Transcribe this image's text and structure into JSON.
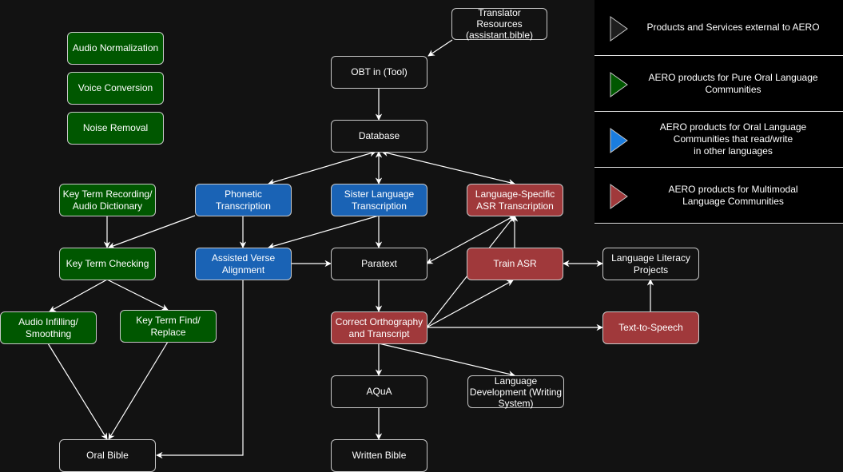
{
  "colors": {
    "background": "#121212",
    "external": "#121212",
    "pure_oral": "#005700",
    "oral_read_write": "#1a63b5",
    "multimodal": "#a0393b",
    "edge": "#ffffff",
    "border": "#c8c8c8"
  },
  "nodes": {
    "translator_resources": "Translator\nResources\n(assistant.bible)",
    "obt_tool": "OBT in (Tool)",
    "database": "Database",
    "audio_normalization": "Audio Normalization",
    "voice_conversion": "Voice Conversion",
    "noise_removal": "Noise Removal",
    "key_term_recording": "Key Term Recording/\nAudio Dictionary",
    "phonetic_transcription": "Phonetic\nTranscription",
    "sister_language_transcription": "Sister Language\nTranscription",
    "language_specific_asr": "Language-Specific\nASR Transcription",
    "key_term_checking": "Key Term Checking",
    "assisted_verse_alignment": "Assisted Verse\nAlignment",
    "paratext": "Paratext",
    "train_asr": "Train ASR",
    "language_literacy_projects": "Language Literacy\nProjects",
    "audio_infilling": "Audio Infilling/\nSmoothing",
    "key_term_find_replace": "Key Term Find/\nReplace",
    "correct_orthography": "Correct Orthography\nand Transcript",
    "text_to_speech": "Text-to-Speech",
    "aqua": "AQuA",
    "language_development": "Language\nDevelopment (Writing\nSystem)",
    "oral_bible": "Oral Bible",
    "written_bible": "Written Bible"
  },
  "legend": [
    {
      "label": "Products and Services external to AERO",
      "icon": "triangle-dark-icon",
      "color": "#1e1e1e"
    },
    {
      "label": "AERO products for Pure Oral Language\nCommunities",
      "icon": "triangle-green-icon",
      "color": "#005700"
    },
    {
      "label": "AERO products for Oral Language\nCommunities that read/write\nin other languages",
      "icon": "triangle-blue-icon",
      "color": "#1a7de0"
    },
    {
      "label": "AERO products for Multimodal\nLanguage Communities",
      "icon": "triangle-red-icon",
      "color": "#a0393b"
    }
  ],
  "edges": [
    {
      "from": "translator_resources",
      "to": "obt_tool",
      "type": "directed"
    },
    {
      "from": "obt_tool",
      "to": "database",
      "type": "directed"
    },
    {
      "from": "database",
      "to": "phonetic_transcription",
      "type": "bidirectional"
    },
    {
      "from": "database",
      "to": "sister_language_transcription",
      "type": "bidirectional"
    },
    {
      "from": "database",
      "to": "language_specific_asr",
      "type": "bidirectional"
    },
    {
      "from": "key_term_recording",
      "to": "key_term_checking",
      "type": "directed"
    },
    {
      "from": "phonetic_transcription",
      "to": "key_term_checking",
      "type": "directed"
    },
    {
      "from": "phonetic_transcription",
      "to": "assisted_verse_alignment",
      "type": "directed"
    },
    {
      "from": "sister_language_transcription",
      "to": "assisted_verse_alignment",
      "type": "directed"
    },
    {
      "from": "sister_language_transcription",
      "to": "paratext",
      "type": "directed"
    },
    {
      "from": "assisted_verse_alignment",
      "to": "paratext",
      "type": "directed"
    },
    {
      "from": "assisted_verse_alignment",
      "to": "oral_bible",
      "type": "directed"
    },
    {
      "from": "paratext",
      "to": "language_specific_asr",
      "type": "bidirectional"
    },
    {
      "from": "train_asr",
      "to": "language_specific_asr",
      "type": "directed"
    },
    {
      "from": "train_asr",
      "to": "language_literacy_projects",
      "type": "bidirectional"
    },
    {
      "from": "key_term_checking",
      "to": "audio_infilling",
      "type": "directed"
    },
    {
      "from": "key_term_checking",
      "to": "key_term_find_replace",
      "type": "directed"
    },
    {
      "from": "audio_infilling",
      "to": "oral_bible",
      "type": "directed"
    },
    {
      "from": "key_term_find_replace",
      "to": "oral_bible",
      "type": "directed"
    },
    {
      "from": "paratext",
      "to": "correct_orthography",
      "type": "directed"
    },
    {
      "from": "correct_orthography",
      "to": "language_specific_asr",
      "type": "directed"
    },
    {
      "from": "correct_orthography",
      "to": "train_asr",
      "type": "directed"
    },
    {
      "from": "correct_orthography",
      "to": "text_to_speech",
      "type": "directed"
    },
    {
      "from": "text_to_speech",
      "to": "language_literacy_projects",
      "type": "directed"
    },
    {
      "from": "correct_orthography",
      "to": "aqua",
      "type": "directed"
    },
    {
      "from": "correct_orthography",
      "to": "language_development",
      "type": "directed"
    },
    {
      "from": "aqua",
      "to": "written_bible",
      "type": "directed"
    }
  ]
}
